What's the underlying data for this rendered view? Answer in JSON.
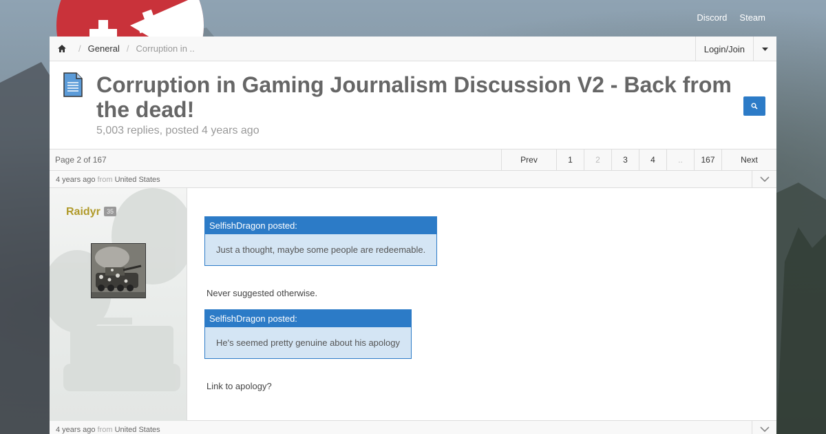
{
  "top_links": [
    "Discord",
    "Steam"
  ],
  "breadcrumb": {
    "items": [
      "General",
      "Corruption in .."
    ]
  },
  "account": {
    "login_label": "Login/Join"
  },
  "thread": {
    "title": "Corruption in Gaming Journalism Discussion V2 - Back from the dead!",
    "subtitle": "5,003 replies, posted 4 years ago"
  },
  "pager": {
    "info": "Page 2 of 167",
    "prev": "Prev",
    "pages": [
      "1",
      "2",
      "3",
      "4",
      "..",
      "167"
    ],
    "current": "2",
    "next": "Next"
  },
  "post": {
    "meta_time": "4 years ago",
    "meta_from": "from",
    "meta_location": "United States",
    "username": "Raidyr",
    "level": "35",
    "quote1_header": "SelfishDragon posted:",
    "quote1_body": "Just a thought, maybe some people are redeemable.",
    "text1": "Never suggested otherwise.",
    "quote2_header": "SelfishDragon posted:",
    "quote2_body": "He's seemed pretty genuine about his apology",
    "text2": "Link to apology?"
  },
  "next_post": {
    "meta_time": "4 years ago",
    "meta_from": "from",
    "meta_location": "United States"
  },
  "colors": {
    "accent": "#2c7bc7",
    "logo_red": "#c9323a",
    "username": "#b09a2a"
  },
  "icons": [
    "home-icon",
    "caret-down-icon",
    "document-icon",
    "search-icon",
    "chevron-down-icon"
  ]
}
